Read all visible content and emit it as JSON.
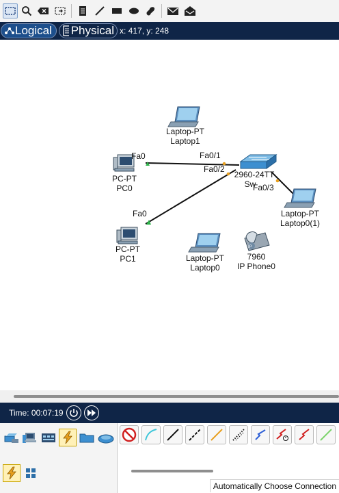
{
  "toolbar": {
    "icons": [
      "select-icon",
      "zoom-icon",
      "delete-icon",
      "resize-icon",
      "note-icon",
      "draw-line-icon",
      "rectangle-icon",
      "ellipse-icon",
      "freeform-icon",
      "simple-pdu-icon",
      "complex-pdu-icon"
    ]
  },
  "viewbar": {
    "logical_label": "Logical",
    "physical_label": "Physical",
    "coords": "x: 417, y: 248"
  },
  "topology": {
    "nodes": [
      {
        "id": "laptop1",
        "type": "Laptop-PT",
        "name": "Laptop1"
      },
      {
        "id": "pc0",
        "type": "PC-PT",
        "name": "PC0"
      },
      {
        "id": "switch",
        "type": "2960-24TT",
        "name": "Sw"
      },
      {
        "id": "laptop0_1",
        "type": "Laptop-PT",
        "name": "Laptop0(1)"
      },
      {
        "id": "pc1",
        "type": "PC-PT",
        "name": "PC1"
      },
      {
        "id": "laptop0",
        "type": "Laptop-PT",
        "name": "Laptop0"
      },
      {
        "id": "ipphone0",
        "type": "7960",
        "name": "IP Phone0"
      }
    ],
    "ports": {
      "pc0_fa0": "Fa0",
      "sw_fa01": "Fa0/1",
      "sw_fa02": "Fa0/2",
      "pc1_fa0": "Fa0",
      "sw_fa03": "Fa0/3"
    }
  },
  "timebar": {
    "time": "Time: 00:07:19"
  },
  "bottom": {
    "status_text": "Automatically Choose Connection"
  },
  "colors": {
    "navy": "#0f2547",
    "switch_blue": "#3d8fd0",
    "link_green": "#2fb34a",
    "link_orange": "#e8a020"
  }
}
